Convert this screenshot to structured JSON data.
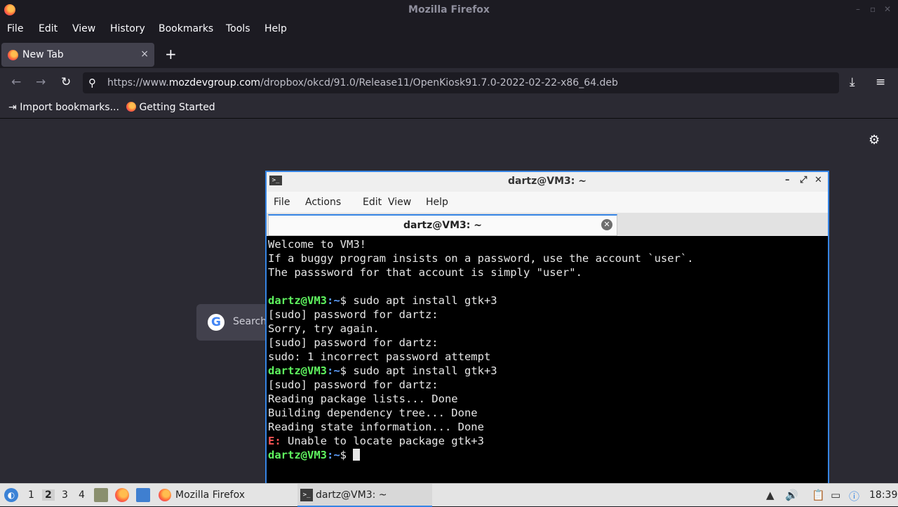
{
  "firefox": {
    "window_title": "Mozilla Firefox",
    "menu": [
      "File",
      "Edit",
      "View",
      "History",
      "Bookmarks",
      "Tools",
      "Help"
    ],
    "tab": {
      "label": "New Tab",
      "close": "×"
    },
    "new_tab": "+",
    "url": {
      "prefix": "https://www.",
      "domain": "mozdevgroup.com",
      "path": "/dropbox/okcd/91.0/Release11/OpenKiosk91.7.0-2022-02-22-x86_64.deb"
    },
    "bookmarks": [
      "Import bookmarks...",
      "Getting Started"
    ],
    "search_placeholder": "Search"
  },
  "terminal": {
    "title": "dartz@VM3: ~",
    "menu": [
      "File",
      "Actions",
      "Edit",
      "View",
      "Help"
    ],
    "tab_label": "dartz@VM3: ~",
    "prompt_user": "dartz@VM3",
    "prompt_path": ":~",
    "prompt_sym": "$ ",
    "lines": {
      "l0": "Welcome to VM3!",
      "l1": "If a buggy program insists on a password, use the account `user`.",
      "l2": "The passsword for that account is simply \"user\".",
      "cmd1": "sudo apt install gtk+3",
      "l4": "[sudo] password for dartz:",
      "l5": "Sorry, try again.",
      "l6": "[sudo] password for dartz:",
      "l7": "sudo: 1 incorrect password attempt",
      "cmd2": "sudo apt install gtk+3",
      "l9": "[sudo] password for dartz:",
      "l10": "Reading package lists... Done",
      "l11": "Building dependency tree... Done",
      "l12": "Reading state information... Done",
      "err_prefix": "E:",
      "l13": " Unable to locate package gtk+3"
    }
  },
  "taskbar": {
    "workspaces": [
      "1",
      "2",
      "3",
      "4"
    ],
    "active_workspace": "2",
    "tasks": [
      "Mozilla Firefox",
      "dartz@VM3: ~"
    ],
    "clock": "18:39"
  }
}
